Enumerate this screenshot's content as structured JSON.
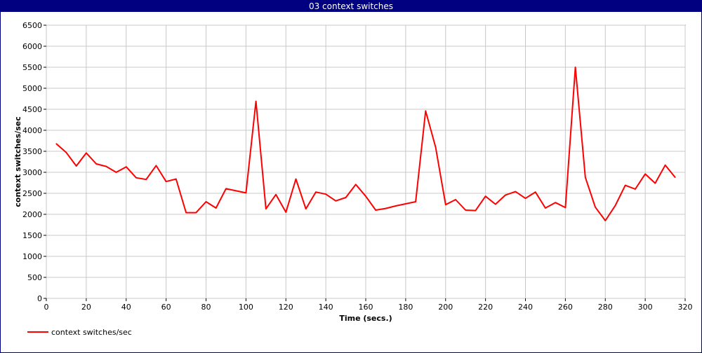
{
  "window": {
    "title": "03 context switches"
  },
  "chart_data": {
    "type": "line",
    "title": "03 context switches",
    "xlabel": "Time (secs.)",
    "ylabel": "context switches/sec",
    "xlim": [
      0,
      320
    ],
    "ylim": [
      0,
      6500
    ],
    "x_ticks": [
      0,
      20,
      40,
      60,
      80,
      100,
      120,
      140,
      160,
      180,
      200,
      220,
      240,
      260,
      280,
      300,
      320
    ],
    "y_ticks": [
      0,
      500,
      1000,
      1500,
      2000,
      2500,
      3000,
      3500,
      4000,
      4500,
      5000,
      5500,
      6000,
      6500
    ],
    "grid": true,
    "legend_position": "bottom-left",
    "series": [
      {
        "name": "context switches/sec",
        "color": "#ff0000",
        "x": [
          5,
          10,
          15,
          20,
          25,
          30,
          35,
          40,
          45,
          50,
          55,
          60,
          65,
          70,
          75,
          80,
          85,
          90,
          95,
          100,
          105,
          110,
          115,
          120,
          125,
          130,
          135,
          140,
          145,
          150,
          155,
          160,
          165,
          170,
          175,
          180,
          185,
          190,
          195,
          200,
          205,
          210,
          215,
          220,
          225,
          230,
          235,
          240,
          245,
          250,
          255,
          260,
          265,
          270,
          275,
          280,
          285,
          290,
          295,
          300,
          305,
          310,
          315
        ],
        "y": [
          3680,
          3470,
          3150,
          3460,
          3200,
          3140,
          3000,
          3130,
          2870,
          2830,
          3160,
          2780,
          2840,
          2040,
          2040,
          2300,
          2150,
          2610,
          2560,
          2510,
          4690,
          2130,
          2470,
          2050,
          2840,
          2130,
          2530,
          2480,
          2320,
          2400,
          2710,
          2430,
          2100,
          2140,
          2200,
          2250,
          2300,
          4460,
          3600,
          2230,
          2350,
          2100,
          2090,
          2430,
          2240,
          2460,
          2540,
          2380,
          2530,
          2150,
          2280,
          2160,
          5500,
          2880,
          2170,
          1850,
          2210,
          2690,
          2600,
          2960,
          2740,
          3170,
          2880
        ]
      }
    ]
  }
}
